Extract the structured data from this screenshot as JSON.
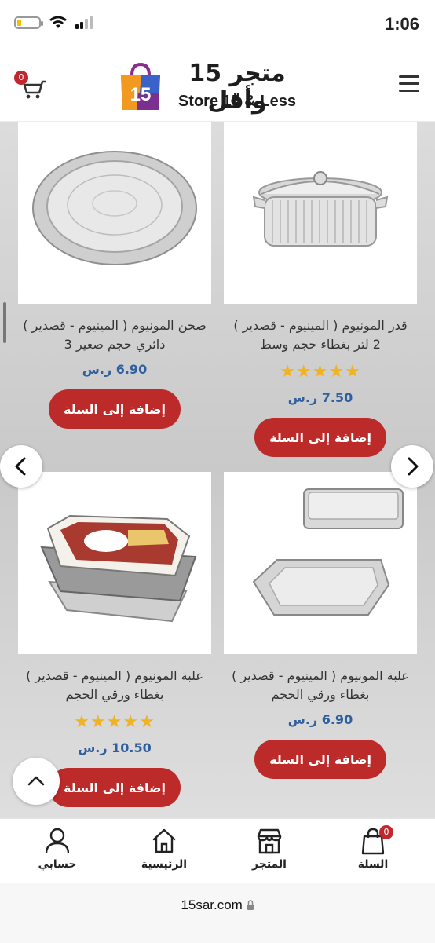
{
  "status_bar": {
    "time": "1:06"
  },
  "header": {
    "logo_ar": "متجر 15 وأقل",
    "logo_en": "Store 15 & Less",
    "logo_bag_text": "15",
    "cart_count": "0"
  },
  "products": [
    {
      "title": "قدر المونيوم ( المينيوم - قصدير ) 2 لتر بغطاء حجم وسط",
      "rating": "★★★★★",
      "price": "7.50 ر.س",
      "button": "إضافة إلى السلة"
    },
    {
      "title": "صحن المونيوم ( المينيوم - قصدير ) دائري حجم صغير 3",
      "rating": "",
      "price": "6.90 ر.س",
      "button": "إضافة إلى السلة"
    },
    {
      "title": "علبة المونيوم ( المينيوم - قصدير ) بغطاء ورقي الحجم",
      "rating": "",
      "price": "6.90 ر.س",
      "button": "إضافة إلى السلة"
    },
    {
      "title": "علبة المونيوم ( المينيوم - قصدير ) بغطاء ورقي الحجم",
      "rating": "★★★★★",
      "price": "10.50 ر.س",
      "button": "إضافة إلى السلة"
    }
  ],
  "bottom_nav": {
    "cart": "السلة",
    "cart_count": "0",
    "store": "المتجر",
    "home": "الرئيسية",
    "account": "حسابي"
  },
  "url_bar": {
    "url": "15sar.com"
  },
  "colors": {
    "accent": "#bd2a2a",
    "price": "#2f5f9e",
    "star": "#f0b323"
  }
}
